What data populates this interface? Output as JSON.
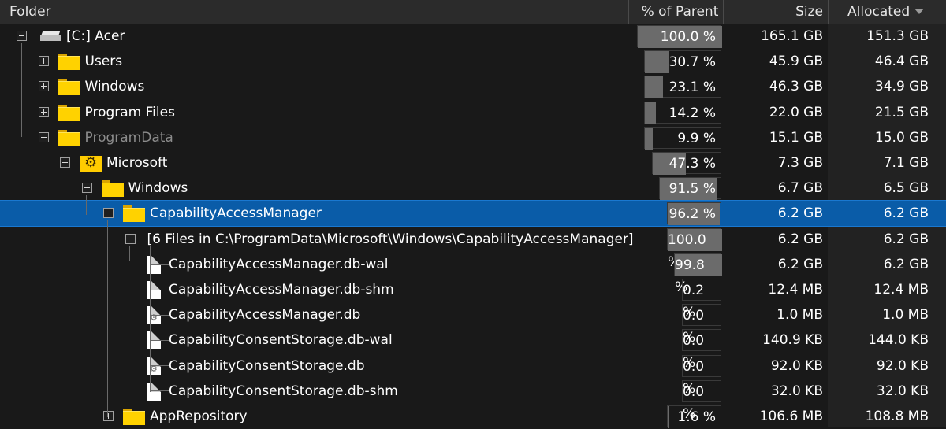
{
  "header": {
    "folder": "Folder",
    "pct_parent": "% of Parent",
    "size": "Size",
    "allocated": "Allocated"
  },
  "rows": [
    {
      "name": "[C:] Acer",
      "pct": "100.0 %",
      "pct_value": 100.0,
      "size": "165.1 GB",
      "alloc": "151.3 GB",
      "icon": "drive-icon",
      "toggle": "minus"
    },
    {
      "name": "Users",
      "pct": "30.7 %",
      "pct_value": 30.7,
      "size": "45.9 GB",
      "alloc": "46.4 GB",
      "icon": "folder-icon",
      "toggle": "plus"
    },
    {
      "name": "Windows",
      "pct": "23.1 %",
      "pct_value": 23.1,
      "size": "46.3 GB",
      "alloc": "34.9 GB",
      "icon": "folder-icon",
      "toggle": "plus"
    },
    {
      "name": "Program Files",
      "pct": "14.2 %",
      "pct_value": 14.2,
      "size": "22.0 GB",
      "alloc": "21.5 GB",
      "icon": "folder-icon",
      "toggle": "plus"
    },
    {
      "name": "ProgramData",
      "pct": "9.9 %",
      "pct_value": 9.9,
      "size": "15.1 GB",
      "alloc": "15.0 GB",
      "icon": "folder-icon",
      "toggle": "minus"
    },
    {
      "name": "Microsoft",
      "pct": "47.3 %",
      "pct_value": 47.3,
      "size": "7.3 GB",
      "alloc": "7.1 GB",
      "icon": "gear-folder-icon",
      "toggle": "minus"
    },
    {
      "name": "Windows",
      "pct": "91.5 %",
      "pct_value": 91.5,
      "size": "6.7 GB",
      "alloc": "6.5 GB",
      "icon": "folder-icon",
      "toggle": "minus"
    },
    {
      "name": "CapabilityAccessManager",
      "pct": "96.2 %",
      "pct_value": 96.2,
      "size": "6.2 GB",
      "alloc": "6.2 GB",
      "icon": "folder-icon",
      "toggle": "minus"
    },
    {
      "name": "[6 Files in C:\\ProgramData\\Microsoft\\Windows\\CapabilityAccessManager]",
      "pct": "100.0 %",
      "pct_value": 100.0,
      "size": "6.2 GB",
      "alloc": "6.2 GB",
      "icon": "none",
      "toggle": "minus"
    },
    {
      "name": "CapabilityAccessManager.db-wal",
      "pct": "99.8 %",
      "pct_value": 99.8,
      "size": "6.2 GB",
      "alloc": "6.2 GB",
      "icon": "file-icon",
      "toggle": "none"
    },
    {
      "name": "CapabilityAccessManager.db-shm",
      "pct": "0.2 %",
      "pct_value": 0.2,
      "size": "12.4 MB",
      "alloc": "12.4 MB",
      "icon": "file-icon",
      "toggle": "none"
    },
    {
      "name": "CapabilityAccessManager.db",
      "pct": "0.0 %",
      "pct_value": 0.0,
      "size": "1.0 MB",
      "alloc": "1.0 MB",
      "icon": "settings-file-icon",
      "toggle": "none"
    },
    {
      "name": "CapabilityConsentStorage.db-wal",
      "pct": "0.0 %",
      "pct_value": 0.0,
      "size": "140.9 KB",
      "alloc": "144.0 KB",
      "icon": "file-icon",
      "toggle": "none"
    },
    {
      "name": "CapabilityConsentStorage.db",
      "pct": "0.0 %",
      "pct_value": 0.0,
      "size": "92.0 KB",
      "alloc": "92.0 KB",
      "icon": "settings-file-icon",
      "toggle": "none"
    },
    {
      "name": "CapabilityConsentStorage.db-shm",
      "pct": "0.0 %",
      "pct_value": 0.0,
      "size": "32.0 KB",
      "alloc": "32.0 KB",
      "icon": "file-icon",
      "toggle": "none"
    },
    {
      "name": "AppRepository",
      "pct": "1.6 %",
      "pct_value": 1.6,
      "size": "106.6 MB",
      "alloc": "108.8 MB",
      "icon": "folder-icon",
      "toggle": "plus"
    }
  ],
  "colors": {
    "background": "#191919",
    "selection": "#0a5ca8",
    "folder": "#ffd200",
    "bar": "#6b6b6b"
  }
}
